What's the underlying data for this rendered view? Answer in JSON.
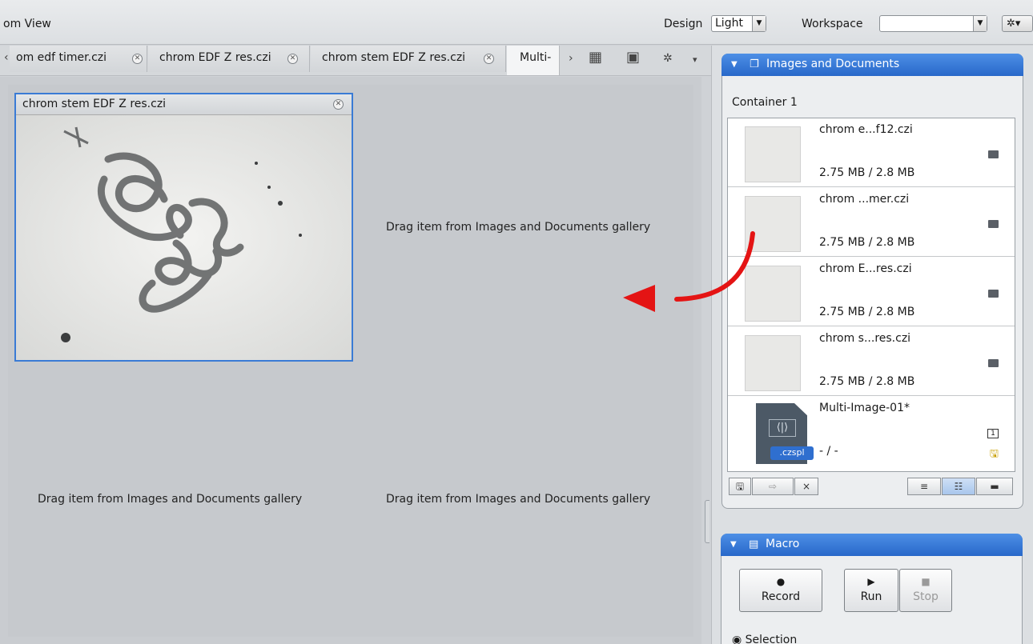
{
  "app": {
    "title": "om View"
  },
  "topbar": {
    "design_label": "Design",
    "design_value": "Light",
    "workspace_label": "Workspace",
    "workspace_value": "",
    "gear_glyph": "✲▾"
  },
  "tabs": [
    {
      "label": "om edf timer.czi",
      "active": false
    },
    {
      "label": "chrom EDF Z res.czi",
      "active": false
    },
    {
      "label": "chrom stem EDF Z res.czi",
      "active": false
    },
    {
      "label": "Multi-",
      "active": true
    }
  ],
  "tab_tools": {
    "left_scroll": "‹",
    "right_scroll": "›",
    "grid_glyph": "▦",
    "split_glyph": "▣",
    "gear_glyph": "✲",
    "menu_glyph": "▾"
  },
  "viewer": {
    "image_title": "chrom stem EDF Z res.czi",
    "drop_hint_1": "Drag item from Images and Documents gallery",
    "drop_hint_2": "Drag item from Images and Documents gallery",
    "drop_hint_3": "Drag item from Images and Documents gallery"
  },
  "images_panel": {
    "title": "Images and Documents",
    "container_label": "Container 1",
    "items": [
      {
        "name": "chrom e...f12.czi",
        "size": "2.75 MB / 2.8 MB"
      },
      {
        "name": "chrom ...mer.czi",
        "size": "2.75 MB / 2.8 MB"
      },
      {
        "name": "chrom E...res.czi",
        "size": "2.75 MB / 2.8 MB"
      },
      {
        "name": "chrom s...res.czi",
        "size": "2.75 MB / 2.8 MB"
      },
      {
        "name": "Multi-Image-01*",
        "size": "- / -",
        "badge": ".czspl",
        "arrows": "⟨|⟩"
      }
    ],
    "toolbar": {
      "save_glyph": "🖫",
      "export_glyph": "⇨",
      "close_glyph": "×",
      "list_glyph": "≡",
      "detail_glyph": "☷",
      "compact_glyph": "▬"
    }
  },
  "macro_panel": {
    "title": "Macro",
    "record_label": "Record",
    "run_label": "Run",
    "stop_label": "Stop",
    "record_glyph": "●",
    "run_glyph": "▶",
    "stop_glyph": "■",
    "selection_label": "Selection"
  },
  "colors": {
    "accent": "#2f6fcf",
    "arrow": "#e41414",
    "selection_border": "#3a7bd5"
  }
}
